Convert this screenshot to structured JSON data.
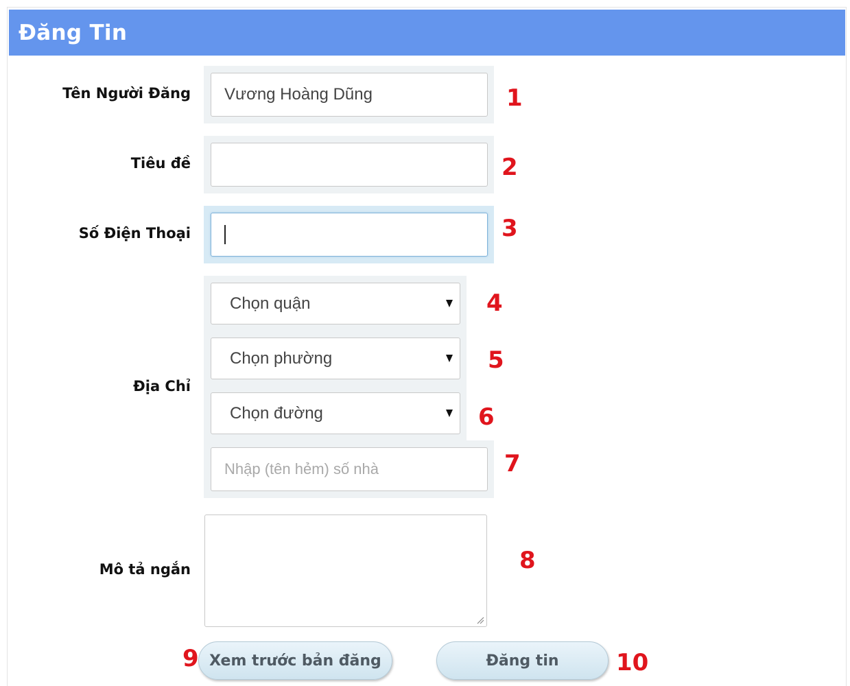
{
  "header": {
    "title": "Đăng Tin"
  },
  "form": {
    "poster_name": {
      "label": "Tên Người Đăng",
      "value": "Vương Hoàng Dũng"
    },
    "title_field": {
      "label": "Tiêu đề",
      "value": ""
    },
    "phone": {
      "label": "Số Điện Thoại",
      "value": ""
    },
    "address": {
      "label": "Địa Chỉ",
      "district_select": "Chọn quận",
      "ward_select": "Chọn phường",
      "street_select": "Chọn đường",
      "house_number_placeholder": "Nhập (tên hẻm) số nhà"
    },
    "description": {
      "label": "Mô tả ngắn",
      "value": ""
    }
  },
  "buttons": {
    "preview": "Xem trước bản đăng",
    "submit": "Đăng tin"
  },
  "annotations": [
    "1",
    "2",
    "3",
    "4",
    "5",
    "6",
    "7",
    "8",
    "9",
    "10"
  ],
  "colors": {
    "header_bg": "#6495ed",
    "annotation": "#e0151d"
  }
}
